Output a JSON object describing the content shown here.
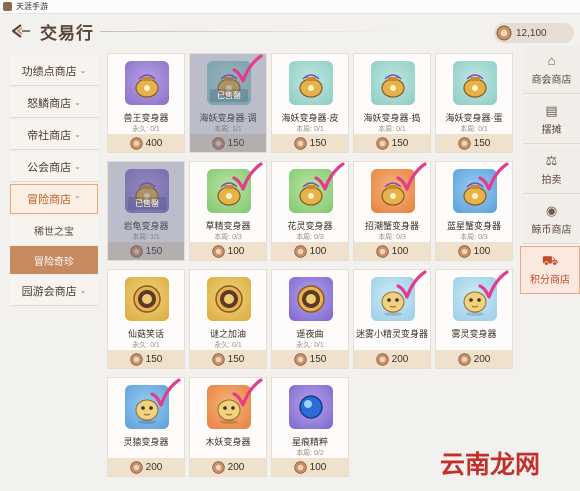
{
  "window": {
    "title": "天涯手游"
  },
  "header": {
    "title": "交易行",
    "currency_amount": "12,100"
  },
  "sidebar": {
    "items": [
      {
        "label": "功绩点商店",
        "expanded": false
      },
      {
        "label": "怒鳞商店",
        "expanded": false
      },
      {
        "label": "帝社商店",
        "expanded": false
      },
      {
        "label": "公会商店",
        "expanded": false
      },
      {
        "label": "冒险商店",
        "expanded": true
      },
      {
        "label": "园游会商店",
        "expanded": false
      }
    ],
    "sub_items": [
      {
        "label": "稀世之宝",
        "active": false
      },
      {
        "label": "冒险奇珍",
        "active": true
      }
    ]
  },
  "rail": {
    "items": [
      {
        "label": "商会商店",
        "icon": "shop-icon",
        "active": false
      },
      {
        "label": "摆摊",
        "icon": "stall-icon",
        "active": false
      },
      {
        "label": "拍卖",
        "icon": "gavel-icon",
        "active": false
      },
      {
        "label": "鲸币商店",
        "icon": "coin-icon",
        "active": false
      },
      {
        "label": "积分商店",
        "icon": "cart-icon",
        "active": true
      }
    ]
  },
  "items": [
    {
      "name": "兽王变身器",
      "limit": "永久: 0/1",
      "price": "400",
      "sold": false,
      "checked": false,
      "theme": "purple",
      "icon": "pouch-icon"
    },
    {
      "name": "海妖变身器·调",
      "limit": "本周: 1/1",
      "price": "150",
      "sold": true,
      "checked": true,
      "theme": "teal",
      "icon": "pouch-icon"
    },
    {
      "name": "海妖变身器·皮",
      "limit": "本周: 0/1",
      "price": "150",
      "sold": false,
      "checked": false,
      "theme": "teal",
      "icon": "pouch-icon"
    },
    {
      "name": "海妖变身器·捣",
      "limit": "本周: 0/1",
      "price": "150",
      "sold": false,
      "checked": false,
      "theme": "teal",
      "icon": "pouch-icon"
    },
    {
      "name": "海妖变身器·蛋",
      "limit": "本周: 0/1",
      "price": "150",
      "sold": false,
      "checked": false,
      "theme": "teal",
      "icon": "pouch-icon"
    },
    {
      "name": "岩龟变身器",
      "limit": "本周: 1/1",
      "price": "150",
      "sold": true,
      "checked": false,
      "theme": "purple",
      "icon": "pouch-icon"
    },
    {
      "name": "草精变身器",
      "limit": "本周: 0/3",
      "price": "100",
      "sold": false,
      "checked": true,
      "theme": "green",
      "icon": "pouch-icon"
    },
    {
      "name": "花灵变身器",
      "limit": "本周: 0/3",
      "price": "100",
      "sold": false,
      "checked": true,
      "theme": "green",
      "icon": "pouch-icon"
    },
    {
      "name": "招潮蟹变身器",
      "limit": "本周: 0/3",
      "price": "100",
      "sold": false,
      "checked": true,
      "theme": "orange",
      "icon": "pouch-icon"
    },
    {
      "name": "蓝星蟹变身器",
      "limit": "本周: 0/3",
      "price": "100",
      "sold": false,
      "checked": true,
      "theme": "blue",
      "icon": "pouch-icon"
    },
    {
      "name": "仙菇笑话",
      "limit": "永久: 0/1",
      "price": "150",
      "sold": false,
      "checked": false,
      "theme": "gold",
      "icon": "medal-icon"
    },
    {
      "name": "谜之加油",
      "limit": "永久: 0/1",
      "price": "150",
      "sold": false,
      "checked": false,
      "theme": "gold",
      "icon": "medal-icon"
    },
    {
      "name": "遥夜曲",
      "limit": "永久: 0/1",
      "price": "150",
      "sold": false,
      "checked": false,
      "theme": "violet",
      "icon": "medal-icon"
    },
    {
      "name": "迷雾小精灵变身器",
      "limit": "",
      "price": "200",
      "sold": false,
      "checked": true,
      "theme": "ice",
      "icon": "creature-icon"
    },
    {
      "name": "雾灵变身器",
      "limit": "",
      "price": "200",
      "sold": false,
      "checked": true,
      "theme": "ice",
      "icon": "creature-icon"
    },
    {
      "name": "灵猿变身器",
      "limit": "",
      "price": "200",
      "sold": false,
      "checked": true,
      "theme": "blue",
      "icon": "creature-icon"
    },
    {
      "name": "木妖变身器",
      "limit": "",
      "price": "200",
      "sold": false,
      "checked": true,
      "theme": "orange",
      "icon": "creature-icon"
    },
    {
      "name": "星痕精粹",
      "limit": "本周: 0/2",
      "price": "100",
      "sold": false,
      "checked": false,
      "theme": "violet",
      "icon": "gem-icon"
    }
  ],
  "labels": {
    "sold_out": "已售罄"
  },
  "watermark": {
    "text": "云南龙网"
  }
}
